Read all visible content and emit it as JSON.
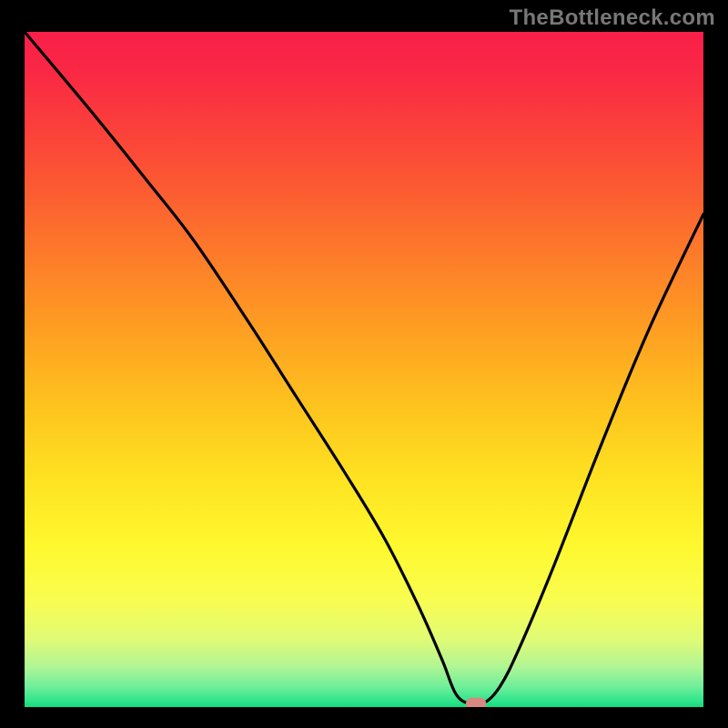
{
  "watermark": "TheBottleneck.com",
  "chart_data": {
    "type": "line",
    "title": "",
    "xlabel": "",
    "ylabel": "",
    "xlim": [
      0,
      100
    ],
    "ylim": [
      0,
      100
    ],
    "background_gradient": {
      "stops": [
        {
          "offset": 0.0,
          "color": "#f91f49"
        },
        {
          "offset": 0.06,
          "color": "#fa2844"
        },
        {
          "offset": 0.14,
          "color": "#fb3f3b"
        },
        {
          "offset": 0.23,
          "color": "#fc5a32"
        },
        {
          "offset": 0.33,
          "color": "#fd7b2a"
        },
        {
          "offset": 0.44,
          "color": "#fe9e22"
        },
        {
          "offset": 0.55,
          "color": "#fec21e"
        },
        {
          "offset": 0.66,
          "color": "#fee221"
        },
        {
          "offset": 0.76,
          "color": "#fff82e"
        },
        {
          "offset": 0.84,
          "color": "#f9fd4f"
        },
        {
          "offset": 0.9,
          "color": "#e0fb76"
        },
        {
          "offset": 0.94,
          "color": "#b0f694"
        },
        {
          "offset": 0.97,
          "color": "#6fee9a"
        },
        {
          "offset": 0.99,
          "color": "#32e58d"
        },
        {
          "offset": 1.0,
          "color": "#14de7a"
        }
      ]
    },
    "curve": {
      "x": [
        0,
        10,
        18,
        25,
        33,
        40,
        47,
        53,
        58,
        61.5,
        63.5,
        65.5,
        67.5,
        70,
        73,
        78,
        85,
        92,
        100
      ],
      "y": [
        100,
        88,
        78,
        69,
        57,
        46,
        35,
        25,
        15,
        7,
        2,
        0.5,
        0.5,
        3,
        9,
        21,
        39,
        56,
        73
      ]
    },
    "marker": {
      "x": 66.5,
      "y": 0.5,
      "color": "#d8897f",
      "width": 3.0,
      "height": 1.8
    }
  }
}
